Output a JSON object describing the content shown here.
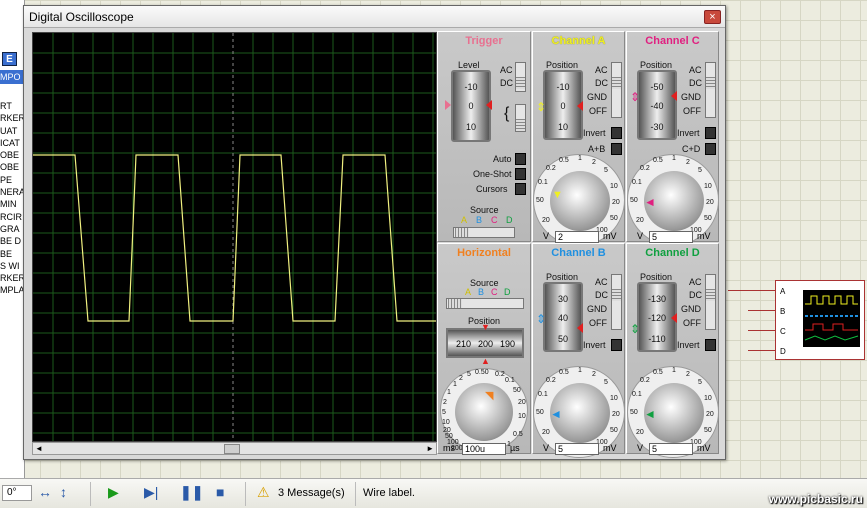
{
  "window": {
    "title": "Digital Oscilloscope",
    "close": "×"
  },
  "left": {
    "btn": "E",
    "head": "MPO",
    "items": [
      "RT",
      "RKER",
      "UAT",
      "ICAT",
      "OBE",
      "OBE",
      "PE",
      "NERA",
      "MIN",
      "RCIR",
      "GRA",
      "BE D",
      "BE",
      "S WI",
      "RKER",
      "MPLA"
    ]
  },
  "trigger": {
    "title": "Trigger",
    "level": "Level",
    "ticks": [
      "-10",
      "0",
      "10"
    ],
    "ac": "AC",
    "dc": "DC",
    "auto": "Auto",
    "oneshot": "One-Shot",
    "cursors": "Cursors",
    "source": "Source",
    "letters": [
      "A",
      "B",
      "C",
      "D"
    ]
  },
  "channelA": {
    "title": "Channel A",
    "position": "Position",
    "ticks": [
      "-10",
      "0",
      "10"
    ],
    "modes": [
      "AC",
      "DC",
      "GND",
      "OFF"
    ],
    "invert": "Invert",
    "combine": "A+B",
    "dial": [
      "0.5",
      "1",
      "2",
      "5",
      "10",
      "20",
      "50",
      "100",
      "200",
      "0.2",
      "0.1",
      "50",
      "20"
    ],
    "value": "2",
    "v": "V",
    "mv": "mV"
  },
  "channelC": {
    "title": "Channel C",
    "position": "Position",
    "ticks": [
      "-50",
      "-40",
      "-30"
    ],
    "modes": [
      "AC",
      "DC",
      "GND",
      "OFF"
    ],
    "invert": "Invert",
    "combine": "C+D",
    "dial": [
      "0.5",
      "1",
      "2",
      "5",
      "10",
      "20",
      "50",
      "100",
      "200",
      "0.2",
      "0.1",
      "50",
      "20"
    ],
    "value": "5",
    "v": "V",
    "mv": "mV"
  },
  "horizontal": {
    "title": "Horizontal",
    "source": "Source",
    "letters": [
      "A",
      "B",
      "C",
      "D"
    ],
    "position": "Position",
    "ticks": [
      "210",
      "200",
      "190"
    ],
    "dial": [
      "0.50",
      "0.2",
      "0.1",
      "50",
      "20",
      "10",
      "5",
      "2",
      "1",
      "1",
      "2",
      "5",
      "10",
      "20",
      "50",
      "100",
      "200",
      "0.5",
      "1"
    ],
    "value": "100u",
    "ms": "ms",
    "us": "µs"
  },
  "channelB": {
    "title": "Channel B",
    "position": "Position",
    "ticks": [
      "30",
      "40",
      "50"
    ],
    "modes": [
      "AC",
      "DC",
      "GND",
      "OFF"
    ],
    "invert": "Invert",
    "dial": [
      "0.5",
      "1",
      "2",
      "5",
      "10",
      "20",
      "50",
      "100",
      "200",
      "0.2",
      "0.1",
      "50",
      "20"
    ],
    "value": "5",
    "v": "V",
    "mv": "mV"
  },
  "channelD": {
    "title": "Channel D",
    "position": "Position",
    "ticks": [
      "-130",
      "-120",
      "-110"
    ],
    "modes": [
      "AC",
      "DC",
      "GND",
      "OFF"
    ],
    "invert": "Invert",
    "dial": [
      "0.5",
      "1",
      "2",
      "5",
      "10",
      "20",
      "50",
      "100",
      "200",
      "0.2",
      "0.1",
      "50",
      "20"
    ],
    "value": "5",
    "v": "V",
    "mv": "mV"
  },
  "instrument": {
    "pins": [
      "A",
      "B",
      "C",
      "D"
    ]
  },
  "statusbar": {
    "angle": "0°",
    "messages": "3 Message(s)",
    "info": "Wire label.",
    "watermark": "www.picbasic.ru"
  },
  "colors": {
    "trigger": "#e87090",
    "a": "#f0f020",
    "b": "#2090e0",
    "c": "#e02080",
    "d": "#10a040",
    "horizontal": "#f08020",
    "trace": "#f0f080"
  }
}
